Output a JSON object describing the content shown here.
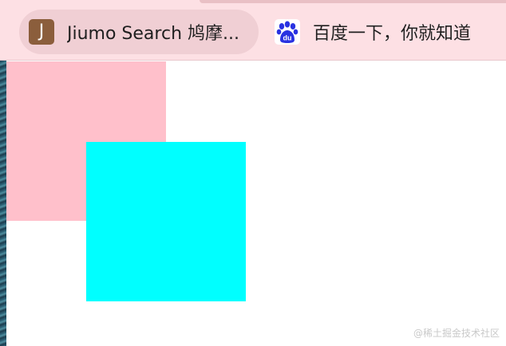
{
  "bookmarks_bar": {
    "items": [
      {
        "label": "Jiumo Search 鸠摩...",
        "favicon_text": "J",
        "favicon_icon": "jiumo-logo-icon",
        "active": true
      },
      {
        "label": "百度一下，你就知道",
        "favicon_text": "du",
        "favicon_icon": "baidu-paw-icon",
        "active": false
      }
    ]
  },
  "content": {
    "pink_box_color": "#ffc0cb",
    "cyan_box_color": "#00ffff"
  },
  "watermark": {
    "text": "@稀土掘金技术社区"
  },
  "colors": {
    "toolbar_bg": "#fde0e4",
    "active_bookmark_bg": "#f0cfd4",
    "baidu_blue": "#2932e1"
  }
}
